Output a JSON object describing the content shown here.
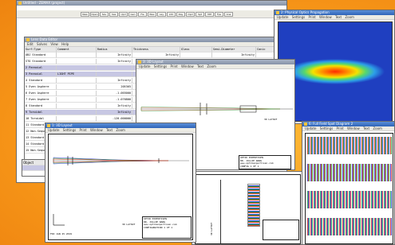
{
  "main_window": {
    "title": "Untitled - ZEMAX (project)",
    "toolbar": [
      "New",
      "Open",
      "Sav",
      "Sas",
      "Upd",
      "Gen",
      "Fie",
      "Wav",
      "Lay",
      "L3d",
      "Ray",
      "Opd",
      "Spt",
      "Mtf",
      "Fps",
      "Ana"
    ]
  },
  "lde": {
    "title": "Lens Data Editor",
    "menu": [
      "Edit",
      "Solves",
      "View",
      "Help"
    ],
    "columns": [
      "Surf:Type",
      "Comment",
      "Radius",
      "Thickness",
      "Glass",
      "Semi-Diameter",
      "Conic"
    ],
    "rows": [
      {
        "surf": "OBJ",
        "type": "Standard",
        "comment": "",
        "radius": "Infinity",
        "thickness": "Infinity",
        "glass": "",
        "semi": "Infinity",
        "conic": "0.0"
      },
      {
        "surf": "STO",
        "type": "Standard",
        "comment": "",
        "radius": "Infinity",
        "thickness": "10.161000",
        "glass": "",
        "semi": "0.350000",
        "conic": "0.0"
      },
      {
        "surf": "2",
        "type": "Paraxial",
        "comment": "",
        "radius": "",
        "thickness": "",
        "glass": "",
        "semi": "",
        "conic": ""
      },
      {
        "surf": "3",
        "type": "Paraxial",
        "comment": "LIGHT PIPE",
        "radius": "",
        "thickness": "",
        "glass": "",
        "semi": "",
        "conic": ""
      },
      {
        "surf": "4",
        "type": "Standard",
        "comment": "",
        "radius": "Infinity",
        "thickness": "",
        "glass": "",
        "semi": "",
        "conic": ""
      },
      {
        "surf": "5",
        "type": "Even Asphere",
        "comment": "",
        "radius": "205365",
        "thickness": "",
        "glass": "",
        "semi": "",
        "conic": ""
      },
      {
        "surf": "6",
        "type": "Even Asphere",
        "comment": "",
        "radius": "-1.065000",
        "thickness": "",
        "glass": "",
        "semi": "",
        "conic": ""
      },
      {
        "surf": "7",
        "type": "Even Asphere",
        "comment": "",
        "radius": "-1.076800",
        "thickness": "",
        "glass": "",
        "semi": "",
        "conic": ""
      },
      {
        "surf": "8",
        "type": "Standard",
        "comment": "",
        "radius": "Infinity",
        "thickness": "",
        "glass": "",
        "semi": "",
        "conic": ""
      },
      {
        "surf": "9",
        "type": "Toroidal",
        "comment": "",
        "radius": "Infinity",
        "thickness": "",
        "glass": "",
        "semi": "",
        "conic": ""
      },
      {
        "surf": "10",
        "type": "Toroidal",
        "comment": "",
        "radius": "-120.000000",
        "thickness": "",
        "glass": "",
        "semi": "",
        "conic": ""
      },
      {
        "surf": "11",
        "type": "Standard",
        "comment": "",
        "radius": "Infinity",
        "thickness": "",
        "glass": "",
        "semi": "",
        "conic": ""
      },
      {
        "surf": "12",
        "type": "Non-Sequential",
        "comment": "",
        "radius": "Infinity",
        "thickness": "",
        "glass": "",
        "semi": "",
        "conic": ""
      },
      {
        "surf": "13",
        "type": "Standard",
        "comment": "",
        "radius": "Infinity",
        "thickness": "",
        "glass": "",
        "semi": "",
        "conic": ""
      },
      {
        "surf": "14",
        "type": "Standard",
        "comment": "",
        "radius": "Infinity",
        "thickness": "",
        "glass": "",
        "semi": "",
        "conic": ""
      },
      {
        "surf": "15",
        "type": "Non-Sequential",
        "comment": "",
        "radius": "Infinity",
        "thickness": "",
        "glass": "",
        "semi": "",
        "conic": ""
      }
    ]
  },
  "beam_window": {
    "title": "2: Physical Optics Propagation",
    "menu": [
      "Update",
      "Settings",
      "Print",
      "Window",
      "Text",
      "Zoom"
    ]
  },
  "layout_small": {
    "title": "3: 3D Layout",
    "menu": [
      "Update",
      "Settings",
      "Print",
      "Window",
      "Text",
      "Zoom"
    ],
    "caption": "3D LAYOUT"
  },
  "layout_main": {
    "title": "1: 3D Layout",
    "menu": [
      "Update",
      "Settings",
      "Print",
      "Window",
      "Text",
      "Zoom"
    ],
    "caption": "3D LAYOUT",
    "date_label": "FRI JAN 25 2019",
    "titleblock": [
      "OPTIK EXPERTISEN",
      "DR. JOLLIE WANG",
      "www.optikexpertisen.com",
      "CONFIGURATION 1 OF 1"
    ]
  },
  "titleblock_small": [
    "OPTIK EXPERTISEN",
    "DR. JOLLIE WANG",
    "www.optikexpertisen.com",
    "CONFIG 1 OF 1"
  ],
  "spot_window": {
    "title": "6: Full Field Spot Diagram 2",
    "menu": [
      "Update",
      "Settings",
      "Print",
      "Window",
      "Text",
      "Zoom"
    ]
  },
  "extra": {
    "vert_label": "3D LAYOUT",
    "side_label": "Object",
    "side_col": "Object"
  },
  "colors": {
    "accent_orange": "#f99a1a",
    "titlebar_blue": "#2e63b8",
    "highlight": "#c7c7e3"
  }
}
